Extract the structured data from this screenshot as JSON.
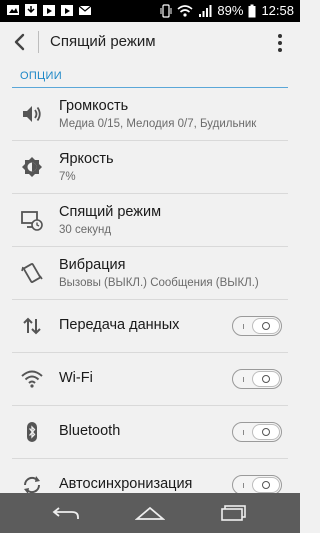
{
  "status_bar": {
    "battery": "89%",
    "time": "12:58",
    "left_icons": [
      "image-icon",
      "download-icon",
      "play-store-icon",
      "play-store-icon",
      "mail-icon"
    ],
    "right_icons": [
      "vibrate-icon",
      "wifi-icon",
      "signal-icon",
      "battery-icon"
    ]
  },
  "action_bar": {
    "title": "Спящий режим",
    "back_icon": "back-arrow-icon",
    "menu_icon": "overflow-menu-icon"
  },
  "section": {
    "label": "ОПЦИИ"
  },
  "items": [
    {
      "title": "Громкость",
      "subtitle": "Медиа 0/15, Мелодия 0/7, Будильник",
      "icon": "volume-icon"
    },
    {
      "title": "Яркость",
      "subtitle": "7%",
      "icon": "brightness-icon"
    },
    {
      "title": "Спящий режим",
      "subtitle": "30 секунд",
      "icon": "screen-timeout-icon"
    },
    {
      "title": "Вибрация",
      "subtitle": "Вызовы (ВЫКЛ.) Сообщения (ВЫКЛ.)",
      "icon": "vibration-icon"
    },
    {
      "title": "Передача данных",
      "icon": "data-transfer-icon",
      "toggle_on": false
    },
    {
      "title": "Wi-Fi",
      "icon": "wifi-icon",
      "toggle_on": false
    },
    {
      "title": "Bluetooth",
      "icon": "bluetooth-icon",
      "toggle_on": false
    },
    {
      "title": "Автосинхронизация",
      "icon": "sync-icon",
      "toggle_on": false
    }
  ],
  "nav_bar": {
    "buttons": [
      "back-nav-icon",
      "home-nav-icon",
      "recent-apps-icon"
    ]
  },
  "colors": {
    "accent": "#1e88c7",
    "status_bar": "#000000",
    "nav_bar": "#5c5c5c",
    "background": "#f1f1f1"
  }
}
